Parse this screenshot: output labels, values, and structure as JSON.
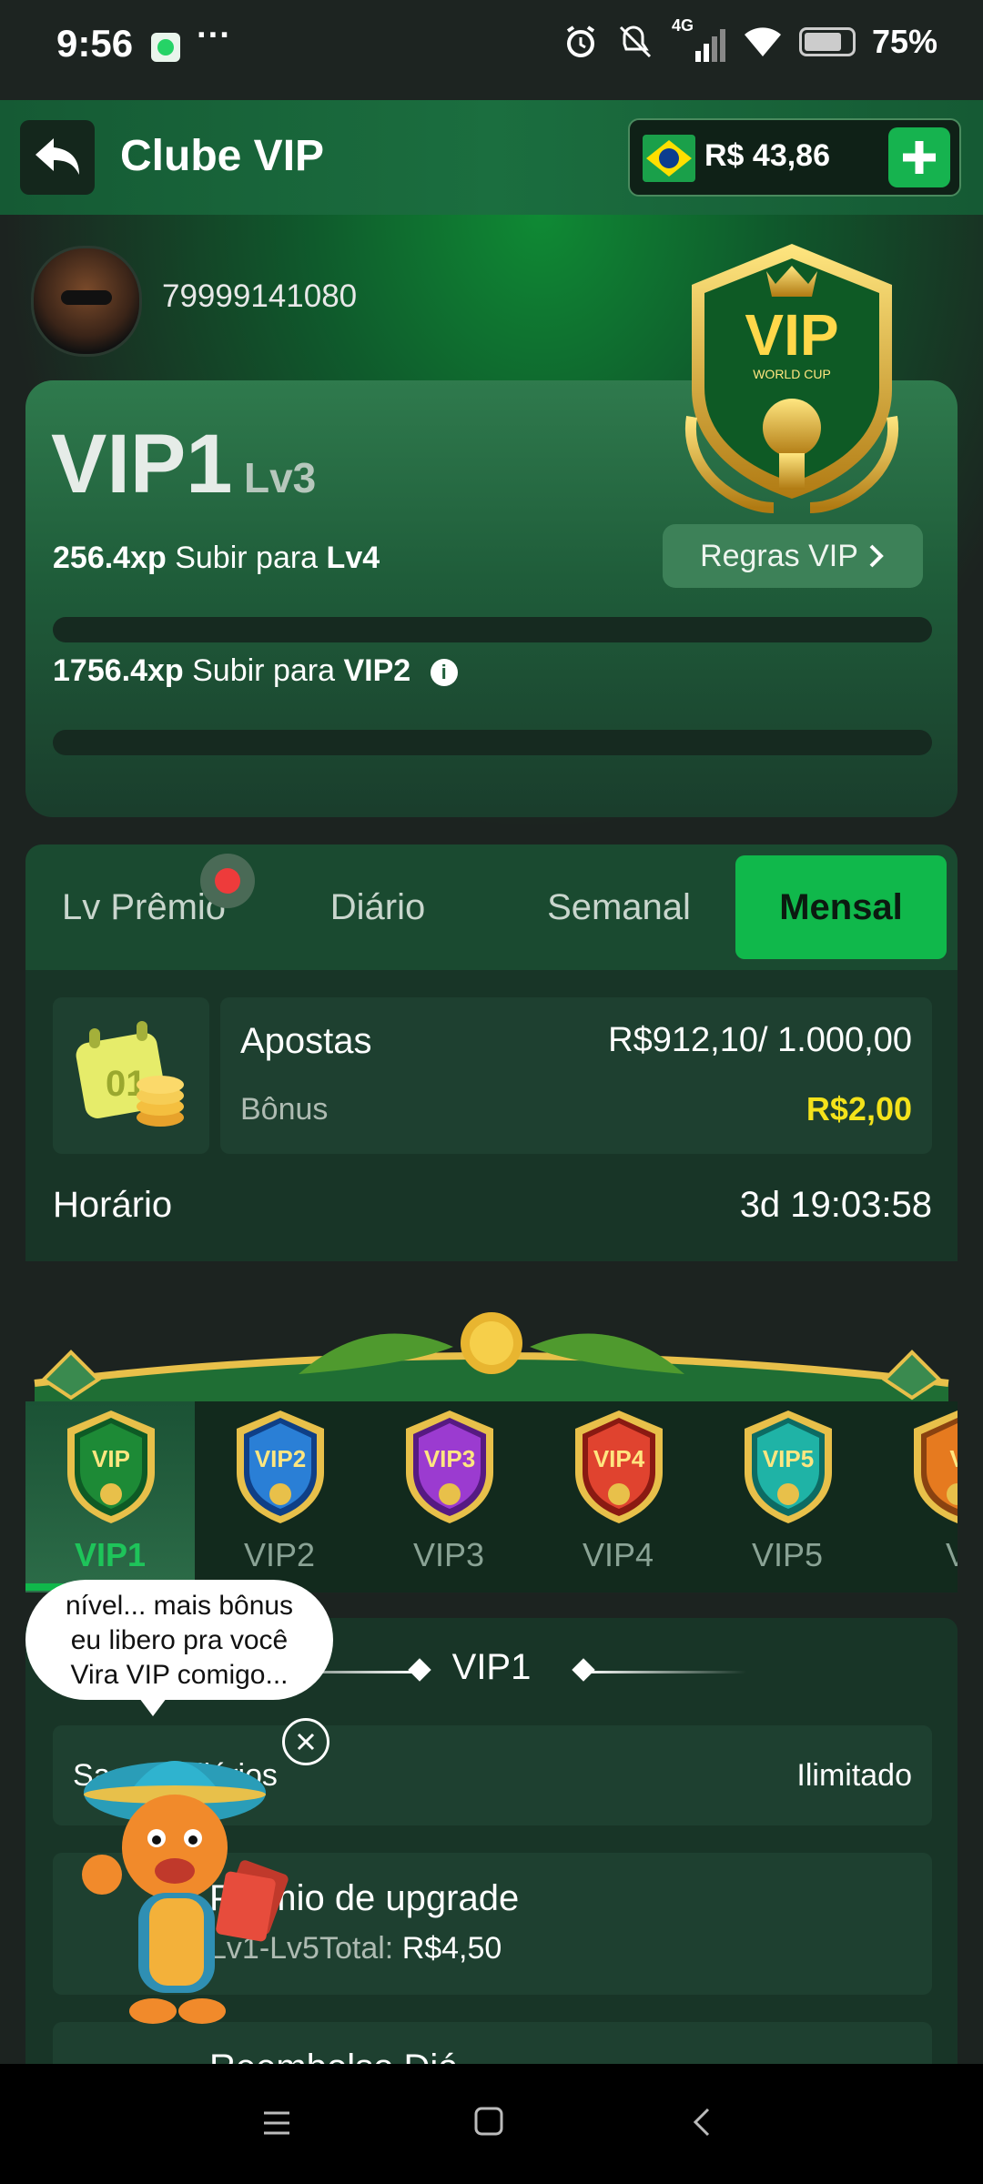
{
  "status_bar": {
    "time": "9:56",
    "more": "···",
    "network": "4G",
    "battery": "75%"
  },
  "header": {
    "title": "Clube VIP",
    "balance": "R$ 43,86"
  },
  "profile": {
    "phone": "79999141080"
  },
  "vip_card": {
    "level": "VIP1",
    "sublevel": "Lv3",
    "rules_label": "Regras VIP",
    "xp_lv": "256.4xp",
    "xp_lv_text": "Subir para",
    "xp_lv_target": "Lv4",
    "xp_vip": "1756.4xp",
    "xp_vip_text": "Subir para",
    "xp_vip_target": "VIP2",
    "badge_text": "VIP",
    "badge_sub": "WORLD CUP"
  },
  "tabs": [
    {
      "label": "Lv Prêmio"
    },
    {
      "label": "Diário"
    },
    {
      "label": "Semanal"
    },
    {
      "label": "Mensal"
    }
  ],
  "task": {
    "title": "Apostas",
    "amount": "R$912,10/ 1.000,00",
    "bonus_label": "Bônus",
    "bonus_value": "R$2,00",
    "time_label": "Horário",
    "time_value": "3d 19:03:58",
    "icon_text": "01"
  },
  "levels": [
    {
      "name": "VIP1",
      "badge": "VIP"
    },
    {
      "name": "VIP2",
      "badge": "VIP2"
    },
    {
      "name": "VIP3",
      "badge": "VIP3"
    },
    {
      "name": "VIP4",
      "badge": "VIP4"
    },
    {
      "name": "VIP5",
      "badge": "VIP5"
    },
    {
      "name": "V",
      "badge": "V"
    }
  ],
  "benefits": {
    "title": "VIP1",
    "rows": [
      {
        "label": "Saques diários",
        "value": "Ilimitado"
      },
      {
        "label": "Prêmio de upgrade",
        "sub_label": "Lv1-Lv5Total:",
        "sub_value": "R$4,50"
      },
      {
        "label": "Reembolso Diá"
      }
    ]
  },
  "mascot": {
    "bubble_line1": "nível... mais bônus",
    "bubble_line2": "eu libero pra você",
    "bubble_line3": "Vira VIP comigo..."
  },
  "colors": {
    "accent": "#10b84b",
    "bonus": "#f4e21b",
    "header": "#155a34"
  }
}
